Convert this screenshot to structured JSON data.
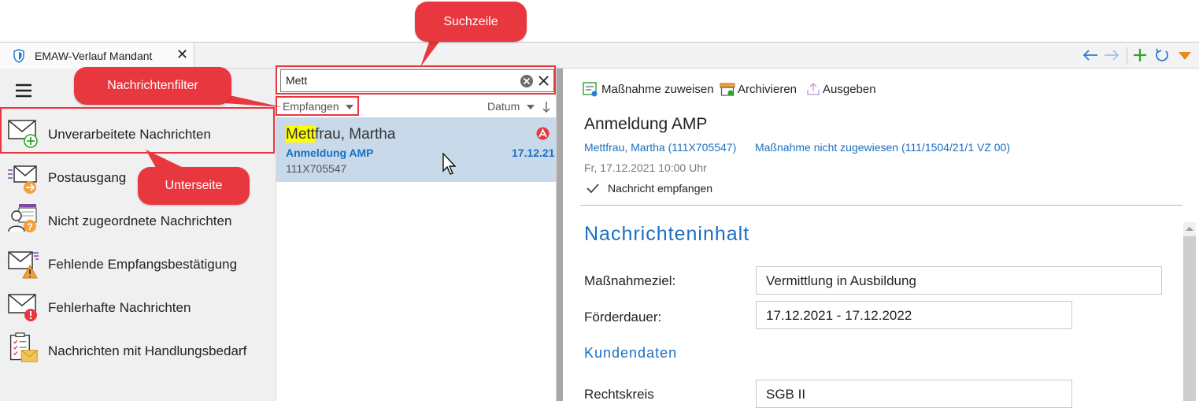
{
  "window": {
    "tab_title": "EMAW-Verlauf Mandant",
    "close_glyph": "✕"
  },
  "callouts": {
    "suchzeile": "Suchzeile",
    "nachrichtenfilter": "Nachrichtenfilter",
    "unterseite": "Unterseite"
  },
  "sidebar": {
    "items": [
      {
        "label": "Unverarbeitete Nachrichten",
        "icon": "mail-add-icon"
      },
      {
        "label": "Postausgang",
        "icon": "mail-outbox-icon"
      },
      {
        "label": "Nicht zugeordnete Nachrichten",
        "icon": "user-question-icon"
      },
      {
        "label": "Fehlende Empfangsbestätigung",
        "icon": "mail-warning-icon"
      },
      {
        "label": "Fehlerhafte Nachrichten",
        "icon": "mail-error-icon"
      },
      {
        "label": "Nachrichten mit Handlungsbedarf",
        "icon": "checklist-mail-icon"
      }
    ]
  },
  "list": {
    "search_value": "Mett",
    "filter_label": "Empfangen",
    "sort_label": "Datum",
    "messages": [
      {
        "name_highlight": "Mett",
        "name_rest": "frau, Martha",
        "subject": "Anmeldung AMP",
        "date": "17.12.21",
        "id": "111X705547"
      }
    ]
  },
  "detail": {
    "toolbar": {
      "assign": "Maßnahme zuweisen",
      "archive": "Archivieren",
      "output": "Ausgeben"
    },
    "title": "Anmeldung AMP",
    "person_link": "Mettfrau, Martha (111X705547)",
    "measure_link": "Maßnahme nicht zugewiesen (111/1504/21/1 VZ 00)",
    "timestamp": "Fr, 17.12.2021 10:00 Uhr",
    "status": "Nachricht empfangen",
    "section_title": "Nachrichteninhalt",
    "fields": [
      {
        "label": "Maßnahmeziel:",
        "value": "Vermittlung in Ausbildung"
      },
      {
        "label": "Förderdauer:",
        "value": "17.12.2021 - 17.12.2022"
      }
    ],
    "subsection": "Kundendaten",
    "rechtskreis_label": "Rechtskreis",
    "rechtskreis_value": "SGB II"
  },
  "colors": {
    "accent": "#1a6fc2",
    "callout": "#e8373f",
    "selection": "#c8d9ea",
    "highlight": "#ffff00"
  }
}
